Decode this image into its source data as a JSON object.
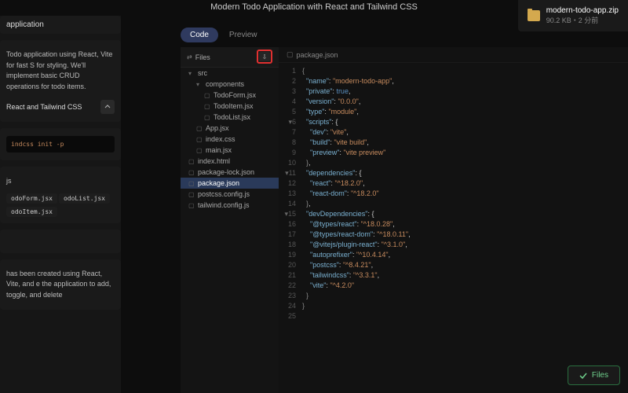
{
  "title": "Modern Todo Application with React and Tailwind CSS",
  "notification": {
    "filename": "modern-todo-app.zip",
    "meta": "90.2 KB・2 分前"
  },
  "left": {
    "header": "application",
    "desc": "Todo application using React, Vite for fast S for styling. We'll implement basic CRUD operations for todo items.",
    "sub_title": "React and Tailwind CSS",
    "cmd": "indcss init -p",
    "ext_js": "js",
    "tags": [
      "odoForm.jsx",
      "odoList.jsx",
      "odoItem.jsx"
    ],
    "footer": "has been created using React, Vite, and e the application to add, toggle, and delete"
  },
  "tabs": {
    "code": "Code",
    "preview": "Preview"
  },
  "files_label": "Files",
  "download_glyph": "⇩",
  "tree": [
    {
      "l": 1,
      "t": "folder-open",
      "n": "src"
    },
    {
      "l": 2,
      "t": "folder-open",
      "n": "components"
    },
    {
      "l": 3,
      "t": "file",
      "n": "TodoForm.jsx"
    },
    {
      "l": 3,
      "t": "file",
      "n": "TodoItem.jsx"
    },
    {
      "l": 3,
      "t": "file",
      "n": "TodoList.jsx"
    },
    {
      "l": 2,
      "t": "file",
      "n": "App.jsx"
    },
    {
      "l": 2,
      "t": "file",
      "n": "index.css"
    },
    {
      "l": 2,
      "t": "file",
      "n": "main.jsx"
    },
    {
      "l": 1,
      "t": "file",
      "n": "index.html"
    },
    {
      "l": 1,
      "t": "file",
      "n": "package-lock.json"
    },
    {
      "l": 1,
      "t": "file",
      "n": "package.json",
      "sel": true
    },
    {
      "l": 1,
      "t": "file",
      "n": "postcss.config.js"
    },
    {
      "l": 1,
      "t": "file",
      "n": "tailwind.config.js"
    }
  ],
  "open_file": "package.json",
  "code_lines": [
    {
      "n": 1,
      "a": "",
      "h": "<span class='p'>{</span>"
    },
    {
      "n": 2,
      "a": "",
      "h": "  <span class='k'>\"name\"</span>: <span class='s'>\"modern-todo-app\"</span>,"
    },
    {
      "n": 3,
      "a": "",
      "h": "  <span class='k'>\"private\"</span>: <span class='b'>true</span>,"
    },
    {
      "n": 4,
      "a": "",
      "h": "  <span class='k'>\"version\"</span>: <span class='s'>\"0.0.0\"</span>,"
    },
    {
      "n": 5,
      "a": "",
      "h": "  <span class='k'>\"type\"</span>: <span class='s'>\"module\"</span>,"
    },
    {
      "n": 6,
      "a": "▾",
      "h": "  <span class='k'>\"scripts\"</span>: {"
    },
    {
      "n": 7,
      "a": "",
      "h": "    <span class='k'>\"dev\"</span>: <span class='s'>\"vite\"</span>,"
    },
    {
      "n": 8,
      "a": "",
      "h": "    <span class='k'>\"build\"</span>: <span class='s'>\"vite build\"</span>,"
    },
    {
      "n": 9,
      "a": "",
      "h": "    <span class='k'>\"preview\"</span>: <span class='s'>\"vite preview\"</span>"
    },
    {
      "n": 10,
      "a": "",
      "h": "  <span class='p'>}</span>,"
    },
    {
      "n": 11,
      "a": "▾",
      "h": "  <span class='k'>\"dependencies\"</span>: {"
    },
    {
      "n": 12,
      "a": "",
      "h": "    <span class='k'>\"react\"</span>: <span class='s'>\"^18.2.0\"</span>,"
    },
    {
      "n": 13,
      "a": "",
      "h": "    <span class='k'>\"react-dom\"</span>: <span class='s'>\"^18.2.0\"</span>"
    },
    {
      "n": 14,
      "a": "",
      "h": "  <span class='p'>}</span>,"
    },
    {
      "n": 15,
      "a": "▾",
      "h": "  <span class='k'>\"devDependencies\"</span>: {"
    },
    {
      "n": 16,
      "a": "",
      "h": "    <span class='k'>\"@types/react\"</span>: <span class='s'>\"^18.0.28\"</span>,"
    },
    {
      "n": 17,
      "a": "",
      "h": "    <span class='k'>\"@types/react-dom\"</span>: <span class='s'>\"^18.0.11\"</span>,"
    },
    {
      "n": 18,
      "a": "",
      "h": "    <span class='k'>\"@vitejs/plugin-react\"</span>: <span class='s'>\"^3.1.0\"</span>,"
    },
    {
      "n": 19,
      "a": "",
      "h": "    <span class='k'>\"autoprefixer\"</span>: <span class='s'>\"^10.4.14\"</span>,"
    },
    {
      "n": 20,
      "a": "",
      "h": "    <span class='k'>\"postcss\"</span>: <span class='s'>\"^8.4.21\"</span>,"
    },
    {
      "n": 21,
      "a": "",
      "h": "    <span class='k'>\"tailwindcss\"</span>: <span class='s'>\"^3.3.1\"</span>,"
    },
    {
      "n": 22,
      "a": "",
      "h": "    <span class='k'>\"vite\"</span>: <span class='s'>\"^4.2.0\"</span>"
    },
    {
      "n": 23,
      "a": "",
      "h": "  <span class='p'>}</span>"
    },
    {
      "n": 24,
      "a": "",
      "h": "<span class='p'>}</span>"
    },
    {
      "n": 25,
      "a": "",
      "h": ""
    }
  ],
  "toast": "Files"
}
